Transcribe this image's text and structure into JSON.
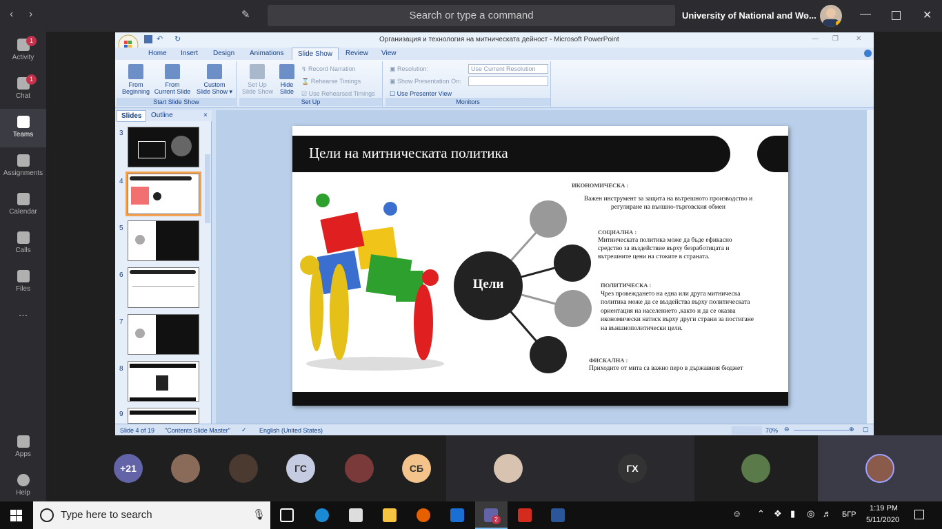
{
  "teams": {
    "search_placeholder": "Search or type a command",
    "org_name": "University of National and Wo...",
    "rail": [
      {
        "label": "Activity",
        "badge": "1"
      },
      {
        "label": "Chat",
        "badge": "1"
      },
      {
        "label": "Teams",
        "badge": ""
      },
      {
        "label": "Assignments",
        "badge": ""
      },
      {
        "label": "Calendar",
        "badge": ""
      },
      {
        "label": "Calls",
        "badge": ""
      },
      {
        "label": "Files",
        "badge": ""
      },
      {
        "label": "...",
        "badge": ""
      }
    ],
    "rail_bottom": [
      {
        "label": "Apps"
      },
      {
        "label": "Help"
      }
    ],
    "participants": [
      {
        "type": "count",
        "text": "+21",
        "color": "#6264a7"
      },
      {
        "type": "photo",
        "text": ""
      },
      {
        "type": "photo",
        "text": ""
      },
      {
        "type": "initials",
        "text": "ГС",
        "color": "#c5cbe0"
      },
      {
        "type": "photo",
        "text": ""
      },
      {
        "type": "initials",
        "text": "СБ",
        "color": "#f3c38b"
      },
      {
        "type": "photo",
        "text": ""
      },
      {
        "type": "initials",
        "text": "ГХ",
        "color": "#333333"
      },
      {
        "type": "photo",
        "text": ""
      },
      {
        "type": "photo",
        "text": ""
      }
    ]
  },
  "ppt": {
    "window_title": "Организация и технология на митническата дейност - Microsoft PowerPoint",
    "tabs": [
      "Home",
      "Insert",
      "Design",
      "Animations",
      "Slide Show",
      "Review",
      "View"
    ],
    "active_tab": "Slide Show",
    "groups": {
      "start": {
        "label": "Start Slide Show",
        "btn1": "From\nBeginning",
        "btn2": "From\nCurrent Slide",
        "btn3": "Custom\nSlide Show ▾"
      },
      "setup": {
        "label": "Set Up",
        "btn1": "Set Up\nSlide Show",
        "btn2": "Hide\nSlide",
        "record": "Record Narration",
        "rehearse": "Rehearse Timings",
        "use_timings": "Use Rehearsed Timings"
      },
      "monitors": {
        "label": "Monitors",
        "resolution": "Resolution:",
        "resolution_value": "Use Current Resolution",
        "show_on": "Show Presentation On:",
        "presenter": "Use Presenter View"
      }
    },
    "pane_tabs": [
      "Slides",
      "Outline"
    ],
    "thumb_numbers": [
      "3",
      "4",
      "5",
      "6",
      "7",
      "8",
      "9"
    ],
    "status": {
      "slide": "Slide 4 of 19",
      "theme": "\"Contents Slide Master\"",
      "lang": "English (United States)",
      "zoom": "70%"
    },
    "slide": {
      "title": "Цели на митническата политика",
      "center": "Цели",
      "items": [
        {
          "heading": "ИКОНОМИЧЕСКА",
          "heading_suffix": " :",
          "body": "Важен инструмент за защита на вътрешното производство и регулиране на външно-търговския обмен"
        },
        {
          "heading": "СОЦИАЛНА :",
          "heading_suffix": "",
          "body": "Митническата политика може да бъде ефикасно средство за въздействие върху безработицата и вътрешните цени на стоките в страната."
        },
        {
          "heading": "ПОЛИТИЧЕСКА",
          "heading_suffix": " :",
          "body": "Чрез провеждането на една или друга митническа политика може да се въздейства върху политическата ориентация на населението ,както и да се оказва икономически натиск върху други страни за постигане на външнополитически цели."
        },
        {
          "heading": "ФИСКАЛНА :",
          "heading_suffix": "",
          "body": "Приходите от мита са важно перо в държавния бюджет"
        }
      ]
    }
  },
  "taskbar": {
    "search_placeholder": "Type here to search",
    "lang": "БГР",
    "time": "1:19 PM",
    "date": "5/11/2020",
    "teams_badge": "2"
  }
}
